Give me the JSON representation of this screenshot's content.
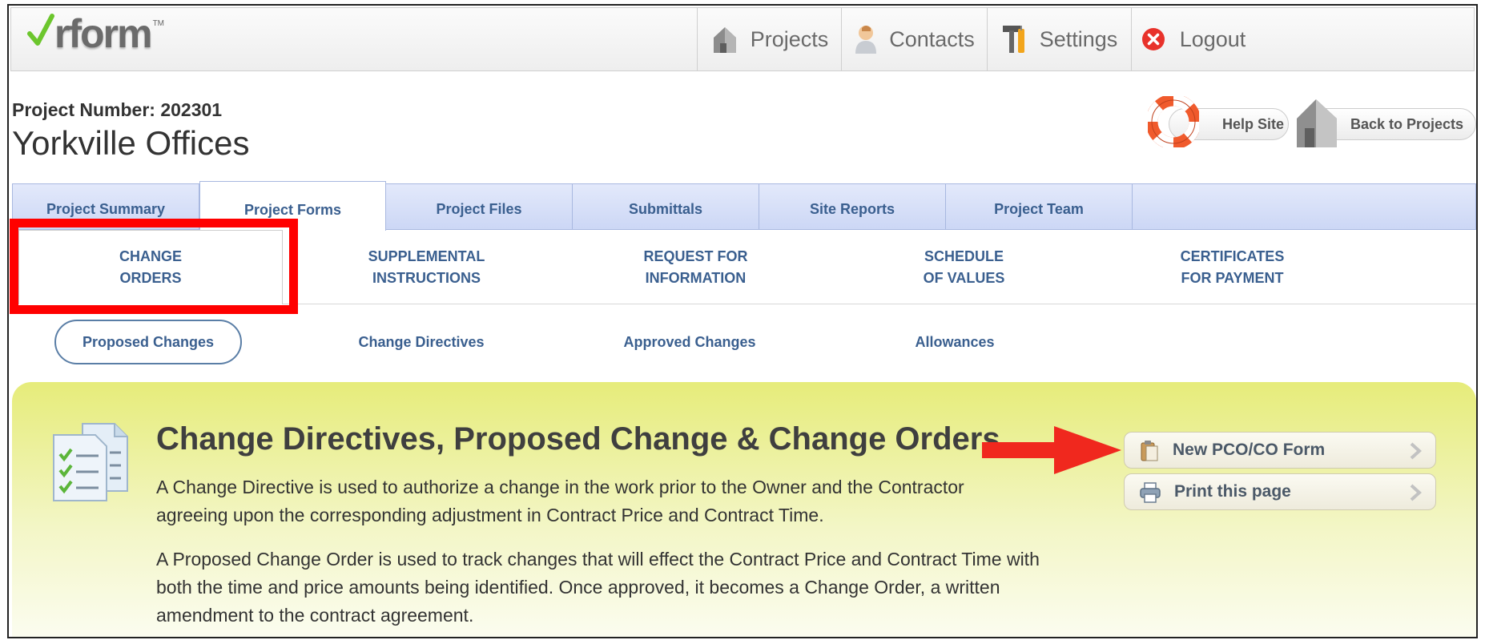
{
  "app": {
    "logo_text": "rform",
    "logo_tm": "TM"
  },
  "topnav": [
    {
      "label": "Projects",
      "icon": "house-icon"
    },
    {
      "label": "Contacts",
      "icon": "person-icon"
    },
    {
      "label": "Settings",
      "icon": "tools-icon"
    },
    {
      "label": "Logout",
      "icon": "logout-icon"
    }
  ],
  "project": {
    "number_label": "Project Number: 202301",
    "name": "Yorkville Offices"
  },
  "header_buttons": {
    "help": "Help Site",
    "back": "Back to Projects"
  },
  "main_tabs": [
    {
      "label": "Project Summary",
      "active": false
    },
    {
      "label": "Project Forms",
      "active": true
    },
    {
      "label": "Project Files",
      "active": false
    },
    {
      "label": "Submittals",
      "active": false
    },
    {
      "label": "Site Reports",
      "active": false
    },
    {
      "label": "Project Team",
      "active": false
    }
  ],
  "sub_tabs": [
    {
      "line1": "CHANGE",
      "line2": "ORDERS",
      "active": true
    },
    {
      "line1": "SUPPLEMENTAL",
      "line2": "INSTRUCTIONS",
      "active": false
    },
    {
      "line1": "REQUEST FOR",
      "line2": "INFORMATION",
      "active": false
    },
    {
      "line1": "SCHEDULE",
      "line2": "OF VALUES",
      "active": false
    },
    {
      "line1": "CERTIFICATES",
      "line2": "FOR PAYMENT",
      "active": false
    }
  ],
  "third_tabs": [
    {
      "label": "Proposed Changes",
      "active": true
    },
    {
      "label": "Change Directives",
      "active": false
    },
    {
      "label": "Approved Changes",
      "active": false
    },
    {
      "label": "Allowances",
      "active": false
    }
  ],
  "panel": {
    "title": "Change Directives, Proposed Change & Change Orders",
    "para1_line1": "A Change Directive is used to authorize a change in the work prior to the Owner and the Contractor",
    "para1_line2": "agreeing upon the corresponding adjustment in Contract Price and Contract Time.",
    "para2_line1": "A Proposed Change Order is used to track changes that will effect the Contract Price and Contract Time with",
    "para2_line2": "both the time and price amounts being identified. Once approved, it becomes a Change Order, a written",
    "para2_line3": "amendment to the contract agreement."
  },
  "actions": {
    "new_form": "New PCO/CO Form",
    "print": "Print this page"
  },
  "colors": {
    "highlight": "#ff0000",
    "arrow": "#f0281e",
    "tab_text": "#3a5f8f",
    "panel": "#e6ec7a"
  }
}
